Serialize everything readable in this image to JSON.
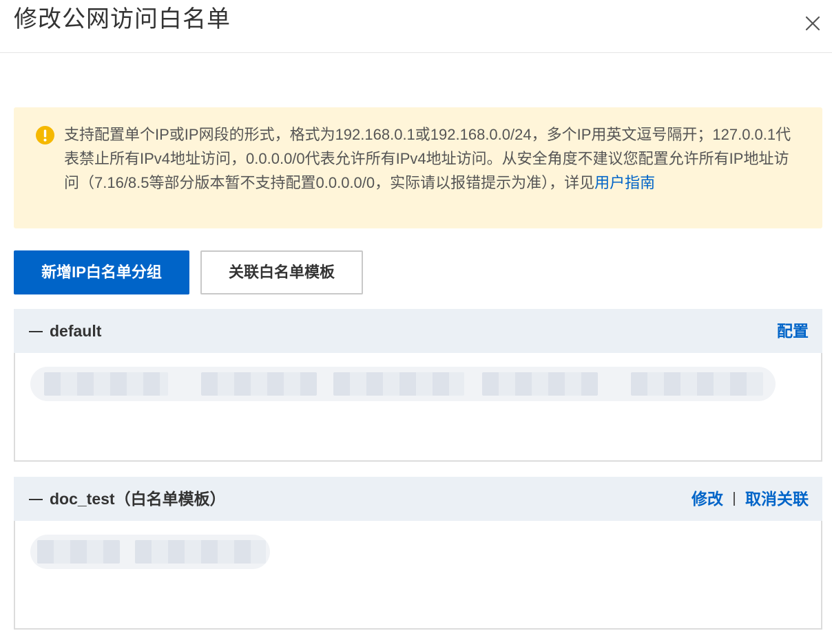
{
  "dialog": {
    "title": "修改公网访问白名单"
  },
  "notice": {
    "text": "支持配置单个IP或IP网段的形式，格式为192.168.0.1或192.168.0.0/24，多个IP用英文逗号隔开；127.0.0.1代表禁止所有IPv4地址访问，0.0.0.0/0代表允许所有IPv4地址访问。从安全角度不建议您配置允许所有IP地址访问（7.16/8.5等部分版本暂不支持配置0.0.0.0/0，实际请以报错提示为准），详见",
    "link_label": "用户指南",
    "icon": "warning-icon",
    "accent": "#f5b800"
  },
  "toolbar": {
    "add_group_label": "新增IP白名单分组",
    "link_template_label": "关联白名单模板"
  },
  "groups": [
    {
      "name": "default",
      "actions": [
        "配置"
      ]
    },
    {
      "name": "doc_test（白名单模板）",
      "actions": [
        "修改",
        "取消关联"
      ]
    }
  ],
  "colors": {
    "primary": "#0064c8",
    "notice_bg": "#fff5d9",
    "group_header_bg": "#ebf0f5"
  }
}
